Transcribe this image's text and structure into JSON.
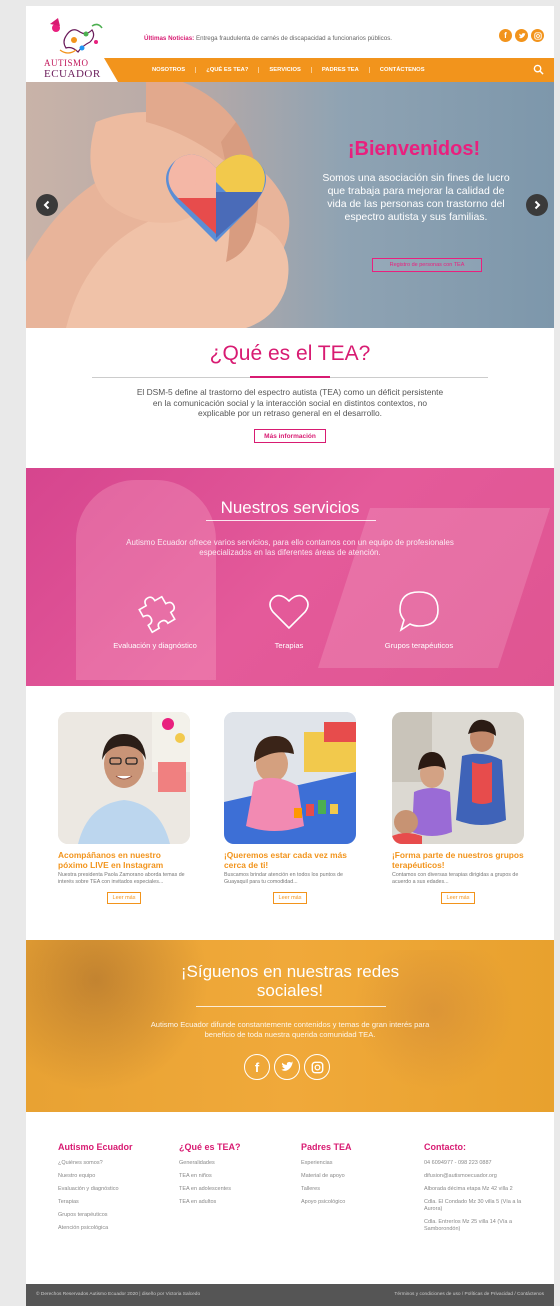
{
  "header": {
    "logo_line1": "AUTISMO",
    "logo_line2": "ECUADOR",
    "news_label": "Últimas Noticias:",
    "news_text": "Entrega fraudulenta de carnés de discapacidad a funcionarios públicos.",
    "social_icons": [
      "facebook-icon",
      "twitter-icon",
      "instagram-icon"
    ],
    "nav": [
      "NOSOTROS",
      "¿QUÉ ES TEA?",
      "SERVICIOS",
      "PADRES TEA",
      "CONTÁCTENOS"
    ]
  },
  "hero": {
    "title": "¡Bienvenidos!",
    "text": "Somos una asociación sin fines de lucro que trabaja para mejorar la calidad de vida de las personas con trastorno del espectro autista y sus familias.",
    "button": "Registro de personas con TEA"
  },
  "tea": {
    "title": "¿Qué es el TEA?",
    "text": "El DSM-5 define al trastorno del espectro autista (TEA) como un déficit persistente en la comunicación social y la interacción social en distintos contextos, no explicable por un retraso general en el desarrollo.",
    "button": "Más información"
  },
  "services": {
    "title": "Nuestros servicios",
    "text": "Autismo Ecuador ofrece varios servicios, para ello contamos con un equipo de profesionales especializados en las diferentes áreas de atención.",
    "items": [
      {
        "label": "Evaluación y diagnóstico",
        "icon": "puzzle-icon"
      },
      {
        "label": "Terapias",
        "icon": "heart-icon"
      },
      {
        "label": "Grupos terapéuticos",
        "icon": "speech-bubble-icon"
      }
    ]
  },
  "cards": [
    {
      "title": "Acompáñanos en nuestro póximo LIVE en Instagram",
      "desc": "Nuestra presidenta Paola Zamorano aborda temas de interés sobre TEA con invitados especiales...",
      "button": "Leer más"
    },
    {
      "title": "¡Queremos estar cada vez más cerca de ti!",
      "desc": "Buscamos brindar atención en todos los puntos de Guayaquil para tu comodidad...",
      "button": "Leer más"
    },
    {
      "title": "¡Forma parte de nuestros grupos terapéuticos!",
      "desc": "Contamos con diversas terapias dirigidas a grupos de acuerdo a sus edades...",
      "button": "Leer más"
    }
  ],
  "social": {
    "title": "¡Síguenos en nuestras redes sociales!",
    "text": "Autismo Ecuador difunde constantemente contenidos y temas de gran interés para beneficio de toda nuestra querida comunidad TEA.",
    "icons": [
      "facebook-icon",
      "twitter-icon",
      "instagram-icon"
    ]
  },
  "footer": {
    "columns": [
      {
        "heading": "Autismo Ecuador",
        "links": [
          "¿Quiénes somos?",
          "Nuestro equipo",
          "Evaluación y diagnóstico",
          "Terapias",
          "Grupos terapéuticos",
          "Atención psicológica"
        ]
      },
      {
        "heading": "¿Qué es TEA?",
        "links": [
          "Generalidades",
          "TEA en niños",
          "TEA en adolescentes",
          "TEA en adultos"
        ]
      },
      {
        "heading": "Padres TEA",
        "links": [
          "Experiencias",
          "Material de apoyo",
          "Talleres",
          "Apoyo psicológico"
        ]
      },
      {
        "heading": "Contacto:",
        "links": [
          "04 6094977 - 098 223 0887",
          "difusion@autismoecuador.org",
          "Alborada décima etapa Mz 42 villa 2",
          "Cdla. El Condado Mz 30 villa 5 (Vía a la Aurora)",
          "Cdla. Entreríos Mz 25 villa 14 (Vía a Samborondón)"
        ]
      }
    ],
    "copyright": "© Derechos Reservados Autismo Ecuador 2020 | diseño por Victoria Salcedo",
    "bottom_links": "Términos y condiciones de uso  /  Políticas de Privacidad  /  Contáctenos"
  },
  "colors": {
    "pink": "#d81b72",
    "orange": "#f2941c",
    "dark": "#555555"
  }
}
